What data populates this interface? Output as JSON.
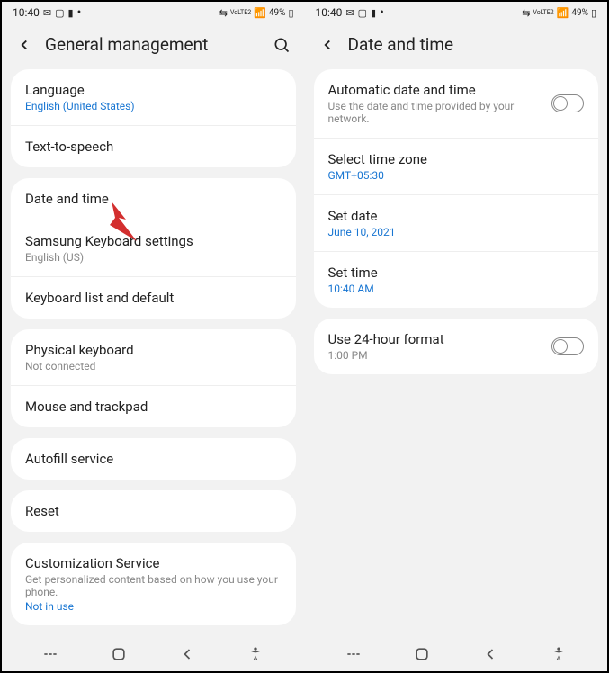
{
  "status": {
    "time": "10:40",
    "battery": "49%"
  },
  "screen1": {
    "title": "General management",
    "rows": {
      "language": {
        "title": "Language",
        "sub": "English (United States)"
      },
      "tts": {
        "title": "Text-to-speech"
      },
      "datetime": {
        "title": "Date and time"
      },
      "keyboard": {
        "title": "Samsung Keyboard settings",
        "sub": "English (US)"
      },
      "keyboardlist": {
        "title": "Keyboard list and default"
      },
      "physical": {
        "title": "Physical keyboard",
        "sub": "Not connected"
      },
      "mouse": {
        "title": "Mouse and trackpad"
      },
      "autofill": {
        "title": "Autofill service"
      },
      "reset": {
        "title": "Reset"
      },
      "custom": {
        "title": "Customization Service",
        "sub": "Get personalized content based on how you use your phone.",
        "sub2": "Not in use"
      }
    }
  },
  "screen2": {
    "title": "Date and time",
    "rows": {
      "auto": {
        "title": "Automatic date and time",
        "sub": "Use the date and time provided by your network."
      },
      "zone": {
        "title": "Select time zone",
        "sub": "GMT+05:30"
      },
      "date": {
        "title": "Set date",
        "sub": "June 10, 2021"
      },
      "time": {
        "title": "Set time",
        "sub": "10:40 AM"
      },
      "h24": {
        "title": "Use 24-hour format",
        "sub": "1:00 PM"
      }
    }
  }
}
